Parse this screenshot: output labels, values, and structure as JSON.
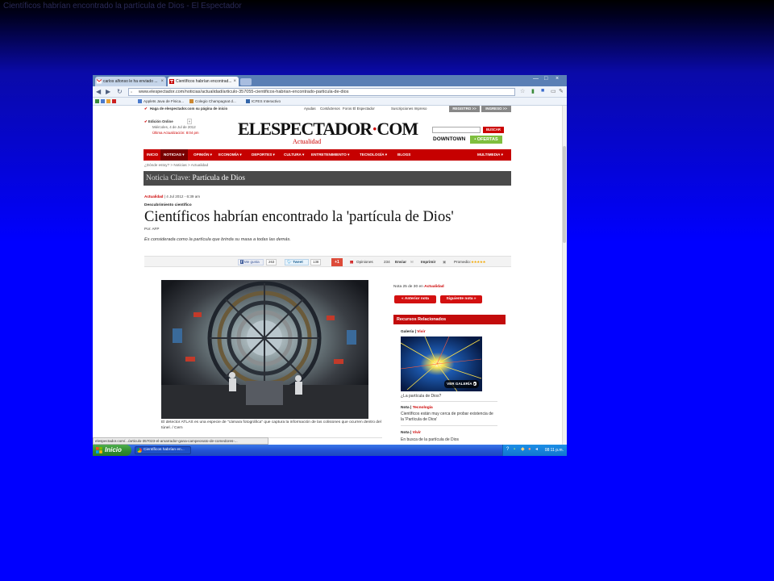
{
  "slide_caption": "Científicos habrían encontrado la partícula de Dios - El Espectador",
  "browser": {
    "tabs": [
      {
        "label": "carlos alfonso le ha enviado ...",
        "close": "×"
      },
      {
        "label": "Científicos habrían encontrad...",
        "close": "×"
      }
    ],
    "url": "www.elespectador.com/noticias/actualidad/articulo-357055-cientificos-habrian-encontrado-particula-de-dios",
    "bookmarks": [
      "Applets Java de Física...",
      "Colegio Champagnat d...",
      "ICFES Interactivo"
    ],
    "status_url": "elespectador.com/.../articulo-357023-el-amarrador-gana-campeonato-de-comedores-...",
    "window_controls": [
      "—",
      "□",
      "×"
    ]
  },
  "site": {
    "top_links": {
      "home_prompt": "Haga de elespectador.com su página de inicio",
      "links": [
        "Ayudas",
        "Contáctenos",
        "Foros El Espectador",
        "Suscripciones Impreso"
      ],
      "registro": "REGISTRO >>",
      "ingreso": "INGRESO >>"
    },
    "edition": "Edición Online",
    "date": "Miércoles, 4 de Jul de 2012",
    "updated": "Última Actualización: 8:04 pm",
    "logo_main": "ELESPECTADOR",
    "logo_dot": "·",
    "logo_com": "COM",
    "logo_section": "Actualidad",
    "search_button": "BUSCAR",
    "downtown": "DOWNTOWN",
    "ofertas": "• OFERTAS",
    "menu": [
      "INICIO",
      "NOTICIAS",
      "OPINIÓN",
      "ECONOMÍA",
      "DEPORTES",
      "CULTURA",
      "ENTRETENIMIENTO",
      "TECNOLOGÍA",
      "BLOGS"
    ],
    "menu_right": "MULTIMEDIA",
    "breadcrumb": "¿Dónde estoy?  >  Noticias  >  Actualidad",
    "key_note_label": "Noticia Clave:",
    "key_note_title": "Partícula de Dios"
  },
  "article": {
    "section": "Actualidad",
    "timestamp": "| 4 Jul 2012 - 6:39 am",
    "kicker": "Descubrimiento científico",
    "headline": "Científicos habrían encontrado la 'partícula de Dios'",
    "byline": "Por: AFP",
    "lead": "Es considerada como la partícula que brinda su masa a todas las demás.",
    "caption": "El detector ATLAS es una especie de \"cámara fotográfica\" que captura la información de las colisiones que ocurren dentro del túnel. / Cern"
  },
  "social": {
    "like_label": "Me gusta",
    "like_count": "263",
    "tweet_label": "Tweet",
    "tweet_count": "138",
    "gplus_label": "+1",
    "opiniones_label": "Opiniones",
    "opiniones_count": "234",
    "enviar": "Enviar",
    "imprimir": "Imprimir",
    "promedio": "Promedio:",
    "stars": "★★★★★"
  },
  "sidebar": {
    "nota_prefix": "Nota 25 de 30 en",
    "nota_section": "Actualidad",
    "prev": "«  Anterior nota",
    "next": "Siguiente nota  »",
    "recursos": "Recursos Relacionados",
    "galeria_label": "Galería |",
    "galeria_section": "Vivir",
    "ver_galeria": "VER GALERÍA",
    "galeria_caption": "¿La partícula de Dios?",
    "nota1_label": "Nota |",
    "nota1_section": "Tecnología",
    "nota1_text": "Científicos están muy cerca de probar existencia de la 'Partícula de Dios'",
    "nota2_label": "Nota |",
    "nota2_section": "Vivir",
    "nota2_text": "En busca de la partícula de Dios"
  },
  "taskbar": {
    "start": "Inicio",
    "task": "Científicos habrían en...",
    "clock": "08:11 p.m."
  },
  "colors": {
    "brand_red": "#c60000",
    "desktop_blue": "#0000ff"
  }
}
